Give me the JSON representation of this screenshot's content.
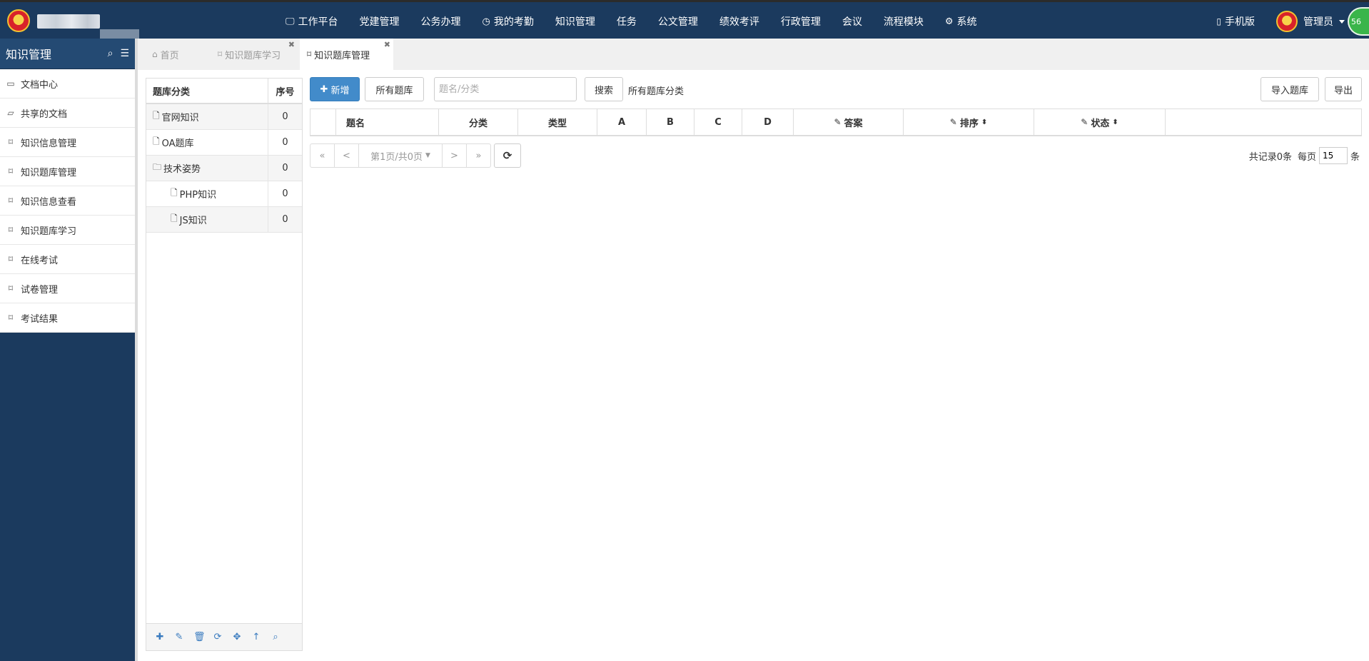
{
  "topbar": {
    "nav": [
      {
        "icon": "monitor-icon",
        "glyph": "🖵",
        "label": "工作平台"
      },
      {
        "label": "党建管理"
      },
      {
        "label": "公务办理"
      },
      {
        "icon": "clock-icon",
        "glyph": "◷",
        "label": "我的考勤"
      },
      {
        "label": "知识管理"
      },
      {
        "label": "任务"
      },
      {
        "label": "公文管理"
      },
      {
        "label": "绩效考评"
      },
      {
        "label": "行政管理"
      },
      {
        "label": "会议"
      },
      {
        "label": "流程模块"
      },
      {
        "icon": "gear-icon",
        "glyph": "⚙",
        "label": "系统"
      }
    ],
    "mobile_label": "手机版",
    "user_name": "管理员",
    "badge": "56"
  },
  "sidebar": {
    "title": "知识管理",
    "items": [
      {
        "icon": "folder-icon",
        "glyph": "▭",
        "label": "文档中心"
      },
      {
        "icon": "folder-open-icon",
        "glyph": "▱",
        "label": "共享的文档"
      },
      {
        "icon": "bookmark-icon",
        "glyph": "⌑",
        "label": "知识信息管理"
      },
      {
        "icon": "bookmark-icon",
        "glyph": "⌑",
        "label": "知识题库管理"
      },
      {
        "icon": "bookmark-icon",
        "glyph": "⌑",
        "label": "知识信息查看"
      },
      {
        "icon": "bookmark-icon",
        "glyph": "⌑",
        "label": "知识题库学习"
      },
      {
        "icon": "bookmark-icon",
        "glyph": "⌑",
        "label": "在线考试"
      },
      {
        "icon": "bookmark-icon",
        "glyph": "⌑",
        "label": "试卷管理"
      },
      {
        "icon": "bookmark-icon",
        "glyph": "⌑",
        "label": "考试结果"
      }
    ]
  },
  "tabs": [
    {
      "label": "首页",
      "icon": "home-icon",
      "closable": false,
      "active": false
    },
    {
      "label": "知识题库学习",
      "icon": "bookmark-icon",
      "closable": true,
      "active": false
    },
    {
      "label": "知识题库管理",
      "icon": "bookmark-icon",
      "closable": true,
      "active": true
    }
  ],
  "category_panel": {
    "header": {
      "name": "题库分类",
      "order": "序号"
    },
    "rows": [
      {
        "name": "官网知识",
        "order": "0",
        "icon": "file-icon",
        "indent": 0
      },
      {
        "name": "OA题库",
        "order": "0",
        "icon": "file-icon",
        "indent": 0
      },
      {
        "name": "技术姿势",
        "order": "0",
        "icon": "folder-icon",
        "indent": 0
      },
      {
        "name": "PHP知识",
        "order": "0",
        "icon": "file-icon",
        "indent": 1
      },
      {
        "name": "JS知识",
        "order": "0",
        "icon": "file-icon",
        "indent": 1
      }
    ],
    "footer_tools": [
      {
        "name": "add-icon",
        "glyph": "✚"
      },
      {
        "name": "edit-icon",
        "glyph": "✎"
      },
      {
        "name": "delete-icon",
        "glyph": "🗑"
      },
      {
        "name": "refresh-icon",
        "glyph": "⟳"
      },
      {
        "name": "move-icon",
        "glyph": "✥"
      },
      {
        "name": "up-arrow-icon",
        "glyph": "↑"
      },
      {
        "name": "search-icon",
        "glyph": "⌕"
      }
    ]
  },
  "toolbar": {
    "add_label": "新增",
    "all_bank_label": "所有题库",
    "search_placeholder": "题名/分类",
    "search_value": "",
    "search_label": "搜索",
    "crumb": "所有题库分类",
    "import_label": "导入题库",
    "export_label": "导出"
  },
  "grid": {
    "columns": [
      {
        "label": "",
        "editable": false,
        "sortable": false
      },
      {
        "label": "题名",
        "editable": false,
        "sortable": false
      },
      {
        "label": "分类",
        "editable": false,
        "sortable": false
      },
      {
        "label": "类型",
        "editable": false,
        "sortable": false
      },
      {
        "label": "A",
        "editable": false,
        "sortable": false
      },
      {
        "label": "B",
        "editable": false,
        "sortable": false
      },
      {
        "label": "C",
        "editable": false,
        "sortable": false
      },
      {
        "label": "D",
        "editable": false,
        "sortable": false
      },
      {
        "label": "答案",
        "editable": true,
        "sortable": false
      },
      {
        "label": "排序",
        "editable": true,
        "sortable": true
      },
      {
        "label": "状态",
        "editable": true,
        "sortable": true
      },
      {
        "label": "",
        "editable": false,
        "sortable": false
      }
    ]
  },
  "pager": {
    "first": "«",
    "prev": "<",
    "page_label": "第1页/共0页",
    "next": ">",
    "last": "»",
    "total_text": "共记录0条",
    "per_page_label": "每页",
    "page_size": "15",
    "unit": "条"
  },
  "colors": {
    "topbar": "#1b3a5e",
    "primary_button": "#428bca",
    "tool_icon": "#3a7bbf"
  }
}
